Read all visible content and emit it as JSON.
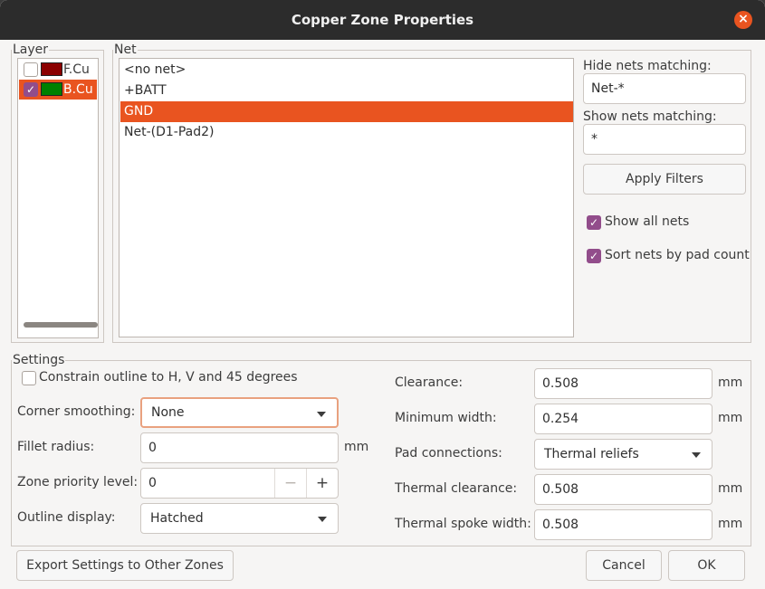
{
  "window": {
    "title": "Copper Zone Properties"
  },
  "layer_group": {
    "label": "Layer",
    "layers": [
      {
        "name": "F.Cu",
        "checked": false,
        "color": "#8b0000"
      },
      {
        "name": "B.Cu",
        "checked": true,
        "color": "#008000"
      }
    ]
  },
  "net_group": {
    "label": "Net",
    "nets": [
      "<no net>",
      "+BATT",
      "GND",
      "Net-(D1-Pad2)"
    ],
    "selected": "GND",
    "hide_label": "Hide nets matching:",
    "hide_value": "Net-*",
    "show_label": "Show nets matching:",
    "show_value": "*",
    "apply_label": "Apply Filters",
    "show_all_label": "Show all nets",
    "sort_label": "Sort nets by pad count"
  },
  "settings": {
    "label": "Settings",
    "constrain_label": "Constrain outline to H, V and 45 degrees",
    "corner_smoothing_label": "Corner smoothing:",
    "corner_smoothing_value": "None",
    "fillet_label": "Fillet radius:",
    "fillet_value": "0",
    "fillet_unit": "mm",
    "priority_label": "Zone priority level:",
    "priority_value": "0",
    "priority_minus": "−",
    "priority_plus": "+",
    "outline_label": "Outline display:",
    "outline_value": "Hatched",
    "clearance_label": "Clearance:",
    "clearance_value": "0.508",
    "clearance_unit": "mm",
    "min_width_label": "Minimum width:",
    "min_width_value": "0.254",
    "min_width_unit": "mm",
    "pad_conn_label": "Pad connections:",
    "pad_conn_value": "Thermal reliefs",
    "thermal_clearance_label": "Thermal clearance:",
    "thermal_clearance_value": "0.508",
    "thermal_clearance_unit": "mm",
    "spoke_label": "Thermal spoke width:",
    "spoke_value": "0.508",
    "spoke_unit": "mm"
  },
  "footer": {
    "export_label": "Export Settings to Other Zones",
    "cancel_label": "Cancel",
    "ok_label": "OK"
  },
  "colors": {
    "accent": "#e95420",
    "checkbox": "#924d8b",
    "titlebar": "#2c2c2c"
  }
}
